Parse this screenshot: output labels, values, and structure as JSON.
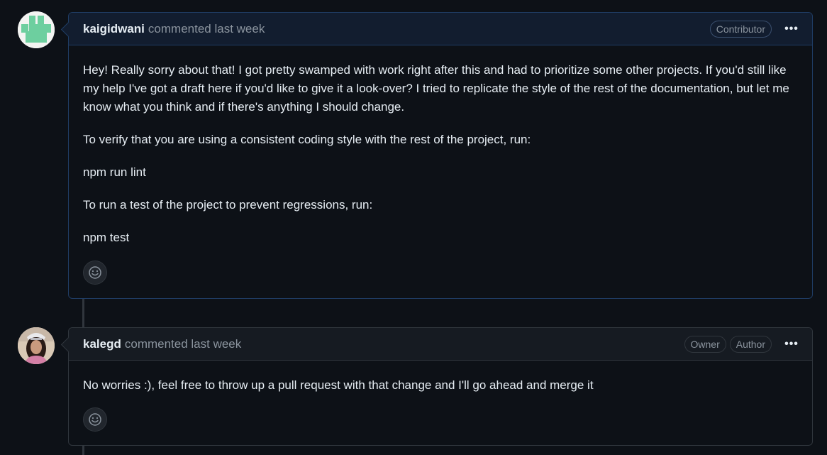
{
  "comments": [
    {
      "author": "kaigidwani",
      "meta": "commented last week",
      "badges": [
        "Contributor"
      ],
      "paragraphs": [
        "Hey! Really sorry about that! I got pretty swamped with work right after this and had to prioritize some other projects. If you'd still like my help I've got a draft here if you'd like to give it a look-over? I tried to replicate the style of the rest of the documentation, but let me know what you think and if there's anything I should change.",
        "To verify that you are using a consistent coding style with the rest of the project, run:",
        "npm run lint",
        "To run a test of the project to prevent regressions, run:",
        "npm test"
      ],
      "more_icon": "kebab-horizontal-icon",
      "reaction_icon": "smiley-icon"
    },
    {
      "author": "kalegd",
      "meta": "commented last week",
      "badges": [
        "Owner",
        "Author"
      ],
      "paragraphs": [
        "No worries :), feel free to throw up a pull request with that change and I'll go ahead and merge it"
      ],
      "more_icon": "kebab-horizontal-icon",
      "reaction_icon": "smiley-icon"
    }
  ],
  "colors": {
    "background": "#0d1117",
    "highlight_header": "#121d2f",
    "header": "#161b22",
    "border": "#30363d",
    "muted_text": "#8b949e"
  }
}
